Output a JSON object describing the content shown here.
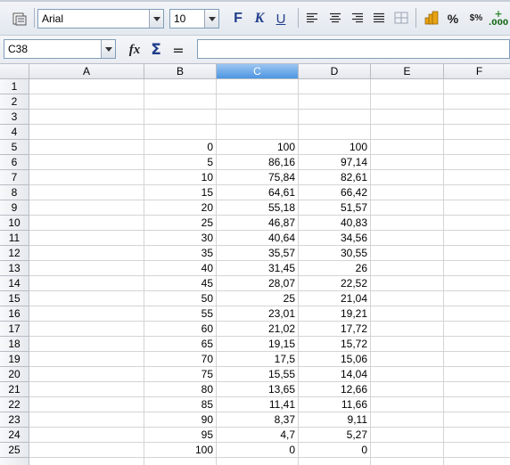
{
  "toolbar": {
    "font_name": "Arial",
    "font_size": "10",
    "bold_label": "F",
    "italic_label": "K",
    "underline_label": "U",
    "percent_label": "%",
    "currency_label": "$%",
    "decimal_label": ".000"
  },
  "formula_bar": {
    "cell_ref": "C38",
    "fx_label": "fx",
    "sum_label": "Σ",
    "equals_label": "=",
    "content": ""
  },
  "sheet": {
    "columns": [
      "A",
      "B",
      "C",
      "D",
      "E",
      "F"
    ],
    "selected_column": "C",
    "row_numbers": [
      "1",
      "2",
      "3",
      "4",
      "5",
      "6",
      "7",
      "8",
      "9",
      "10",
      "11",
      "12",
      "13",
      "14",
      "15",
      "16",
      "17",
      "18",
      "19",
      "20",
      "21",
      "22",
      "23",
      "24",
      "25"
    ],
    "data_rows": [
      {
        "row": 5,
        "B": "0",
        "C": "100",
        "D": "100"
      },
      {
        "row": 6,
        "B": "5",
        "C": "86,16",
        "D": "97,14"
      },
      {
        "row": 7,
        "B": "10",
        "C": "75,84",
        "D": "82,61"
      },
      {
        "row": 8,
        "B": "15",
        "C": "64,61",
        "D": "66,42"
      },
      {
        "row": 9,
        "B": "20",
        "C": "55,18",
        "D": "51,57"
      },
      {
        "row": 10,
        "B": "25",
        "C": "46,87",
        "D": "40,83"
      },
      {
        "row": 11,
        "B": "30",
        "C": "40,64",
        "D": "34,56"
      },
      {
        "row": 12,
        "B": "35",
        "C": "35,57",
        "D": "30,55"
      },
      {
        "row": 13,
        "B": "40",
        "C": "31,45",
        "D": "26"
      },
      {
        "row": 14,
        "B": "45",
        "C": "28,07",
        "D": "22,52"
      },
      {
        "row": 15,
        "B": "50",
        "C": "25",
        "D": "21,04"
      },
      {
        "row": 16,
        "B": "55",
        "C": "23,01",
        "D": "19,21"
      },
      {
        "row": 17,
        "B": "60",
        "C": "21,02",
        "D": "17,72"
      },
      {
        "row": 18,
        "B": "65",
        "C": "19,15",
        "D": "15,72"
      },
      {
        "row": 19,
        "B": "70",
        "C": "17,5",
        "D": "15,06"
      },
      {
        "row": 20,
        "B": "75",
        "C": "15,55",
        "D": "14,04"
      },
      {
        "row": 21,
        "B": "80",
        "C": "13,65",
        "D": "12,66"
      },
      {
        "row": 22,
        "B": "85",
        "C": "11,41",
        "D": "11,66"
      },
      {
        "row": 23,
        "B": "90",
        "C": "8,37",
        "D": "9,11"
      },
      {
        "row": 24,
        "B": "95",
        "C": "4,7",
        "D": "5,27"
      },
      {
        "row": 25,
        "B": "100",
        "C": "0",
        "D": "0"
      }
    ]
  }
}
